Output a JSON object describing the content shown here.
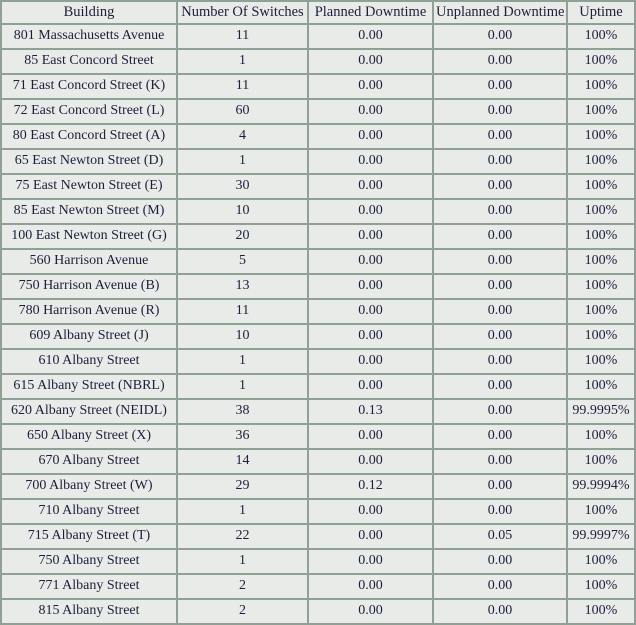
{
  "table": {
    "name": "building-uptime-table",
    "columns": [
      {
        "key": "building",
        "label": "Building"
      },
      {
        "key": "switches",
        "label": "Number Of Switches"
      },
      {
        "key": "planned",
        "label": "Planned Downtime"
      },
      {
        "key": "unplanned",
        "label": "Unplanned Downtime"
      },
      {
        "key": "uptime",
        "label": "Uptime"
      }
    ],
    "colors": {
      "border": "#8fa096",
      "cell_background": "#e9ebe9",
      "tint_lavender": "#e7e5ec",
      "tint_green": "#8ccd4e",
      "tint_red": "#f0b3a8",
      "text": "#1b1f3b"
    },
    "rows": [
      {
        "building": "801 Massachusetts Avenue",
        "switches": "11",
        "planned": "0.00",
        "planned_tint": "lavender",
        "unplanned": "0.00",
        "unplanned_tint": "none",
        "uptime": "100%",
        "uptime_tint": "none"
      },
      {
        "building": "85 East Concord Street",
        "switches": "1",
        "planned": "0.00",
        "planned_tint": "none",
        "unplanned": "0.00",
        "unplanned_tint": "none",
        "uptime": "100%",
        "uptime_tint": "none"
      },
      {
        "building": "71 East Concord Street (K)",
        "switches": "11",
        "planned": "0.00",
        "planned_tint": "none",
        "unplanned": "0.00",
        "unplanned_tint": "none",
        "uptime": "100%",
        "uptime_tint": "none"
      },
      {
        "building": "72 East Concord Street (L)",
        "switches": "60",
        "planned": "0.00",
        "planned_tint": "lavender",
        "unplanned": "0.00",
        "unplanned_tint": "none",
        "uptime": "100%",
        "uptime_tint": "none"
      },
      {
        "building": "80 East Concord Street (A)",
        "switches": "4",
        "planned": "0.00",
        "planned_tint": "none",
        "unplanned": "0.00",
        "unplanned_tint": "none",
        "uptime": "100%",
        "uptime_tint": "none"
      },
      {
        "building": "65 East Newton Street (D)",
        "switches": "1",
        "planned": "0.00",
        "planned_tint": "none",
        "unplanned": "0.00",
        "unplanned_tint": "none",
        "uptime": "100%",
        "uptime_tint": "none"
      },
      {
        "building": "75 East Newton Street (E)",
        "switches": "30",
        "planned": "0.00",
        "planned_tint": "none",
        "unplanned": "0.00",
        "unplanned_tint": "none",
        "uptime": "100%",
        "uptime_tint": "none"
      },
      {
        "building": "85 East Newton Street (M)",
        "switches": "10",
        "planned": "0.00",
        "planned_tint": "none",
        "unplanned": "0.00",
        "unplanned_tint": "none",
        "uptime": "100%",
        "uptime_tint": "none"
      },
      {
        "building": "100 East Newton Street (G)",
        "switches": "20",
        "planned": "0.00",
        "planned_tint": "none",
        "unplanned": "0.00",
        "unplanned_tint": "none",
        "uptime": "100%",
        "uptime_tint": "none"
      },
      {
        "building": "560 Harrison Avenue",
        "switches": "5",
        "planned": "0.00",
        "planned_tint": "none",
        "unplanned": "0.00",
        "unplanned_tint": "none",
        "uptime": "100%",
        "uptime_tint": "none"
      },
      {
        "building": "750 Harrison Avenue (B)",
        "switches": "13",
        "planned": "0.00",
        "planned_tint": "none",
        "unplanned": "0.00",
        "unplanned_tint": "none",
        "uptime": "100%",
        "uptime_tint": "none"
      },
      {
        "building": "780 Harrison Avenue (R)",
        "switches": "11",
        "planned": "0.00",
        "planned_tint": "none",
        "unplanned": "0.00",
        "unplanned_tint": "none",
        "uptime": "100%",
        "uptime_tint": "none"
      },
      {
        "building": "609 Albany Street (J)",
        "switches": "10",
        "planned": "0.00",
        "planned_tint": "none",
        "unplanned": "0.00",
        "unplanned_tint": "none",
        "uptime": "100%",
        "uptime_tint": "none"
      },
      {
        "building": "610 Albany Street",
        "switches": "1",
        "planned": "0.00",
        "planned_tint": "none",
        "unplanned": "0.00",
        "unplanned_tint": "none",
        "uptime": "100%",
        "uptime_tint": "none"
      },
      {
        "building": "615 Albany Street (NBRL)",
        "switches": "1",
        "planned": "0.00",
        "planned_tint": "none",
        "unplanned": "0.00",
        "unplanned_tint": "none",
        "uptime": "100%",
        "uptime_tint": "none"
      },
      {
        "building": "620 Albany Street (NEIDL)",
        "switches": "38",
        "planned": "0.13",
        "planned_tint": "green",
        "unplanned": "0.00",
        "unplanned_tint": "none",
        "uptime": "99.9995%",
        "uptime_tint": "green"
      },
      {
        "building": "650 Albany Street (X)",
        "switches": "36",
        "planned": "0.00",
        "planned_tint": "lavender",
        "unplanned": "0.00",
        "unplanned_tint": "none",
        "uptime": "100%",
        "uptime_tint": "none"
      },
      {
        "building": "670 Albany Street",
        "switches": "14",
        "planned": "0.00",
        "planned_tint": "lavender",
        "unplanned": "0.00",
        "unplanned_tint": "none",
        "uptime": "100%",
        "uptime_tint": "none"
      },
      {
        "building": "700 Albany Street (W)",
        "switches": "29",
        "planned": "0.12",
        "planned_tint": "green",
        "unplanned": "0.00",
        "unplanned_tint": "none",
        "uptime": "99.9994%",
        "uptime_tint": "green"
      },
      {
        "building": "710 Albany Street",
        "switches": "1",
        "planned": "0.00",
        "planned_tint": "lavender",
        "unplanned": "0.00",
        "unplanned_tint": "none",
        "uptime": "100%",
        "uptime_tint": "none"
      },
      {
        "building": "715 Albany Street (T)",
        "switches": "22",
        "planned": "0.00",
        "planned_tint": "none",
        "unplanned": "0.05",
        "unplanned_tint": "red",
        "uptime": "99.9997%",
        "uptime_tint": "red"
      },
      {
        "building": "750 Albany Street",
        "switches": "1",
        "planned": "0.00",
        "planned_tint": "lavender",
        "unplanned": "0.00",
        "unplanned_tint": "none",
        "uptime": "100%",
        "uptime_tint": "none"
      },
      {
        "building": "771 Albany Street",
        "switches": "2",
        "planned": "0.00",
        "planned_tint": "none",
        "unplanned": "0.00",
        "unplanned_tint": "none",
        "uptime": "100%",
        "uptime_tint": "none"
      },
      {
        "building": "815 Albany Street",
        "switches": "2",
        "planned": "0.00",
        "planned_tint": "none",
        "unplanned": "0.00",
        "unplanned_tint": "none",
        "uptime": "100%",
        "uptime_tint": "none"
      }
    ]
  }
}
